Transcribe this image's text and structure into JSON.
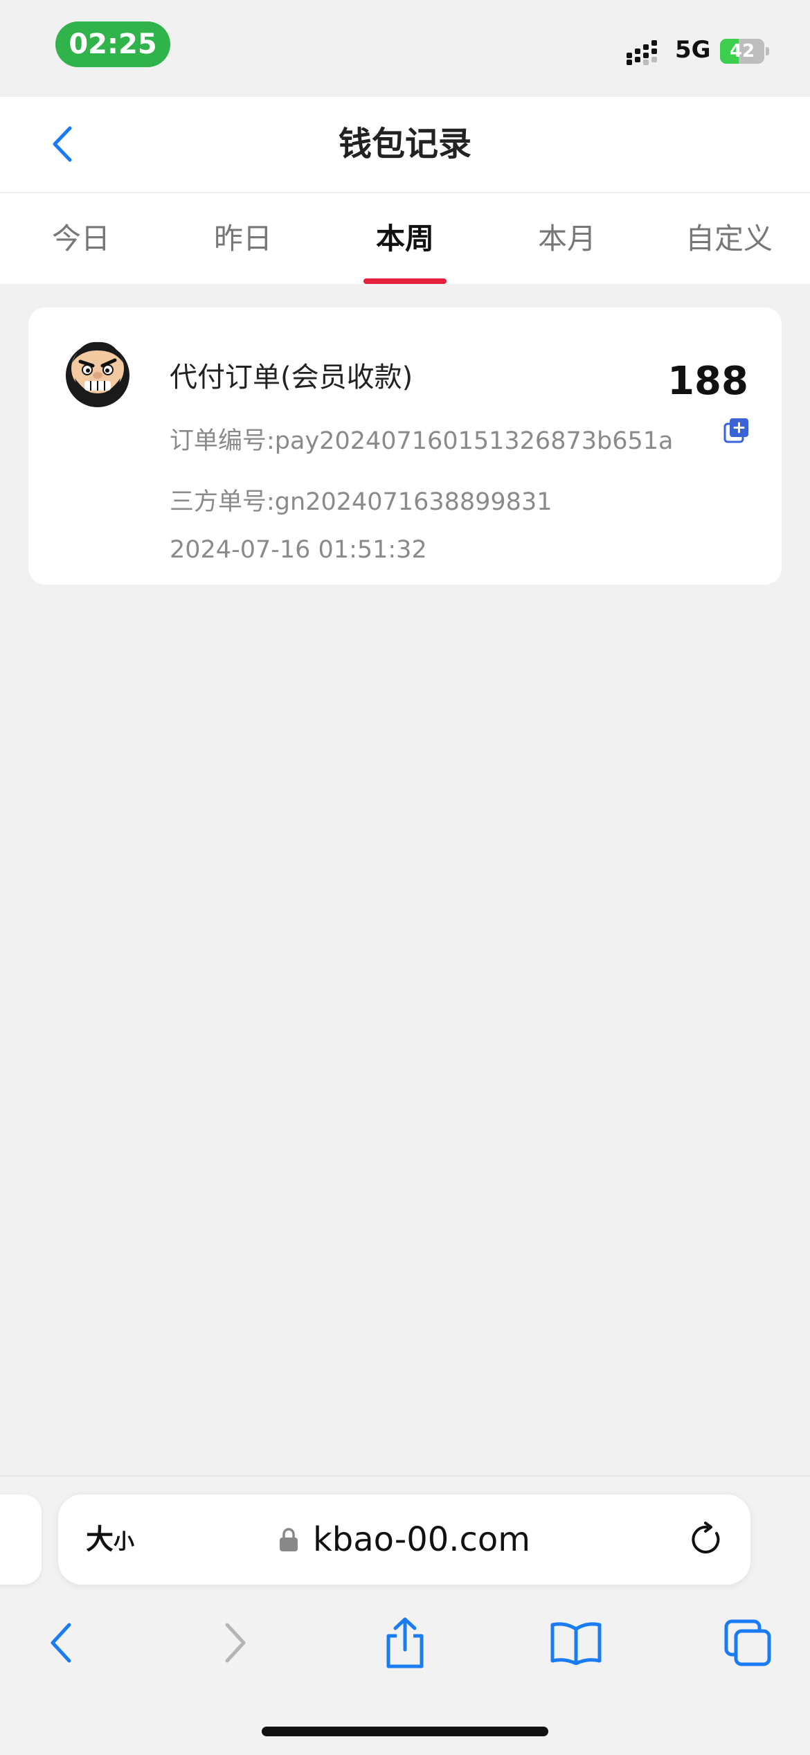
{
  "status_bar": {
    "time": "02:25",
    "network": "5G",
    "battery_level": "42",
    "battery_fraction": 0.42
  },
  "navbar": {
    "title": "钱包记录"
  },
  "tabs": [
    {
      "label": "今日",
      "active": false
    },
    {
      "label": "昨日",
      "active": false
    },
    {
      "label": "本周",
      "active": true
    },
    {
      "label": "本月",
      "active": false
    },
    {
      "label": "自定义",
      "active": false
    }
  ],
  "record": {
    "title": "代付订单(会员收款)",
    "amount": "188",
    "order_label": "订单编号:",
    "order_no": "pay20240716015132687​3b651a",
    "third_label": "三方单号:",
    "third_no": "gn2024071638899831",
    "time": "2024-07-16 01:51:32"
  },
  "browser": {
    "text_size_big": "大",
    "text_size_small": "小",
    "url": "kbao-00.com"
  },
  "colors": {
    "accent_tab": "#e5213d",
    "ios_blue": "#1a7cf2",
    "status_green": "#2fb34a"
  }
}
